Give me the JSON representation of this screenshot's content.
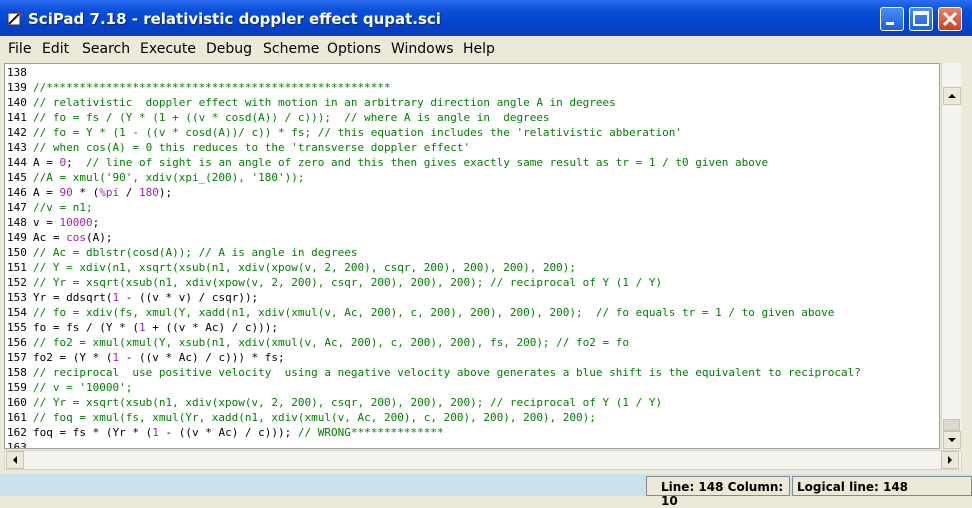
{
  "window": {
    "title": "SciPad 7.18 - relativistic doppler effect qupat.sci"
  },
  "menu": [
    "File",
    "Edit",
    "Search",
    "Execute",
    "Debug",
    "Scheme",
    "Options",
    "Windows",
    "Help"
  ],
  "lines": [
    {
      "n": "138",
      "parts": []
    },
    {
      "n": "139",
      "parts": [
        [
          "c",
          "//****************************************************"
        ]
      ]
    },
    {
      "n": "140",
      "parts": [
        [
          "c",
          "// relativistic  doppler effect with motion in an arbitrary direction angle A in degrees"
        ]
      ]
    },
    {
      "n": "141",
      "parts": [
        [
          "c",
          "// fo = fs / (Y * (1 + ((v * cosd(A)) / c)));  // where A is angle in  degrees"
        ]
      ]
    },
    {
      "n": "142",
      "parts": [
        [
          "c",
          "// fo = Y * (1 - ((v * cosd(A))/ c)) * fs; // this equation includes the 'relativistic abberation'"
        ]
      ]
    },
    {
      "n": "143",
      "parts": [
        [
          "c",
          "// when cos(A) = 0 this reduces to the 'transverse doppler effect'"
        ]
      ]
    },
    {
      "n": "144",
      "parts": [
        [
          "t",
          "A = "
        ],
        [
          "n",
          "0"
        ],
        [
          "t",
          ";  "
        ],
        [
          "c",
          "// line of sight is an angle of zero and this then gives exactly same result as tr = 1 / t0 given above"
        ]
      ]
    },
    {
      "n": "145",
      "parts": [
        [
          "c",
          "//A = xmul('90', xdiv(xpi_(200), '180'));"
        ]
      ]
    },
    {
      "n": "146",
      "parts": [
        [
          "t",
          "A = "
        ],
        [
          "n",
          "90"
        ],
        [
          "t",
          " * ("
        ],
        [
          "n",
          "%pi"
        ],
        [
          "t",
          " / "
        ],
        [
          "n",
          "180"
        ],
        [
          "t",
          ");"
        ]
      ]
    },
    {
      "n": "147",
      "parts": [
        [
          "c",
          "//v = n1;"
        ]
      ]
    },
    {
      "n": "148",
      "parts": [
        [
          "t",
          "v = "
        ],
        [
          "n",
          "10000"
        ],
        [
          "t",
          ";"
        ]
      ]
    },
    {
      "n": "149",
      "parts": [
        [
          "t",
          "Ac = "
        ],
        [
          "n",
          "cos"
        ],
        [
          "t",
          "(A);"
        ]
      ]
    },
    {
      "n": "150",
      "parts": [
        [
          "c",
          "// Ac = dblstr(cosd(A)); // A is angle in degrees"
        ]
      ]
    },
    {
      "n": "151",
      "parts": [
        [
          "c",
          "// Y = xdiv(n1, xsqrt(xsub(n1, xdiv(xpow(v, 2, 200), csqr, 200), 200), 200), 200);"
        ]
      ]
    },
    {
      "n": "152",
      "parts": [
        [
          "c",
          "// Yr = xsqrt(xsub(n1, xdiv(xpow(v, 2, 200), csqr, 200), 200), 200); // reciprocal of Y (1 / Y)"
        ]
      ]
    },
    {
      "n": "153",
      "parts": [
        [
          "t",
          "Yr = ddsqrt("
        ],
        [
          "n",
          "1"
        ],
        [
          "t",
          " - ((v * v) / csqr));"
        ]
      ]
    },
    {
      "n": "154",
      "parts": [
        [
          "c",
          "// fo = xdiv(fs, xmul(Y, xadd(n1, xdiv(xmul(v, Ac, 200), c, 200), 200), 200), 200);  // fo equals tr = 1 / to given above"
        ]
      ]
    },
    {
      "n": "155",
      "parts": [
        [
          "t",
          "fo = fs / (Y * ("
        ],
        [
          "n",
          "1"
        ],
        [
          "t",
          " + ((v * Ac) / c)));"
        ]
      ]
    },
    {
      "n": "156",
      "parts": [
        [
          "c",
          "// fo2 = xmul(xmul(Y, xsub(n1, xdiv(xmul(v, Ac, 200), c, 200), 200), fs, 200); // fo2 = fo"
        ]
      ]
    },
    {
      "n": "157",
      "parts": [
        [
          "t",
          "fo2 = (Y * ("
        ],
        [
          "n",
          "1"
        ],
        [
          "t",
          " - ((v * Ac) / c))) * fs;"
        ]
      ]
    },
    {
      "n": "158",
      "parts": [
        [
          "c",
          "// reciprocal  use positive velocity  using a negative velocity above generates a blue shift is the equivalent to reciprocal?"
        ]
      ]
    },
    {
      "n": "159",
      "parts": [
        [
          "c",
          "// v = '10000';"
        ]
      ]
    },
    {
      "n": "160",
      "parts": [
        [
          "c",
          "// Yr = xsqrt(xsub(n1, xdiv(xpow(v, 2, 200), csqr, 200), 200), 200); // reciprocal of Y (1 / Y)"
        ]
      ]
    },
    {
      "n": "161",
      "parts": [
        [
          "c",
          "// foq = xmul(fs, xmul(Yr, xadd(n1, xdiv(xmul(v, Ac, 200), c, 200), 200), 200), 200);"
        ]
      ]
    },
    {
      "n": "162",
      "parts": [
        [
          "t",
          "foq = fs * (Yr * ("
        ],
        [
          "n",
          "1"
        ],
        [
          "t",
          " - ((v * Ac) / c))); "
        ],
        [
          "c",
          "// WRONG**************"
        ]
      ]
    },
    {
      "n": "163",
      "parts": []
    }
  ],
  "status": {
    "line_col": "Line: 148 Column: 10",
    "logical": "Logical line: 148"
  },
  "colors": {
    "comment": "#008000",
    "number": "#a020c0",
    "title_bar": "#0a4fd8"
  }
}
